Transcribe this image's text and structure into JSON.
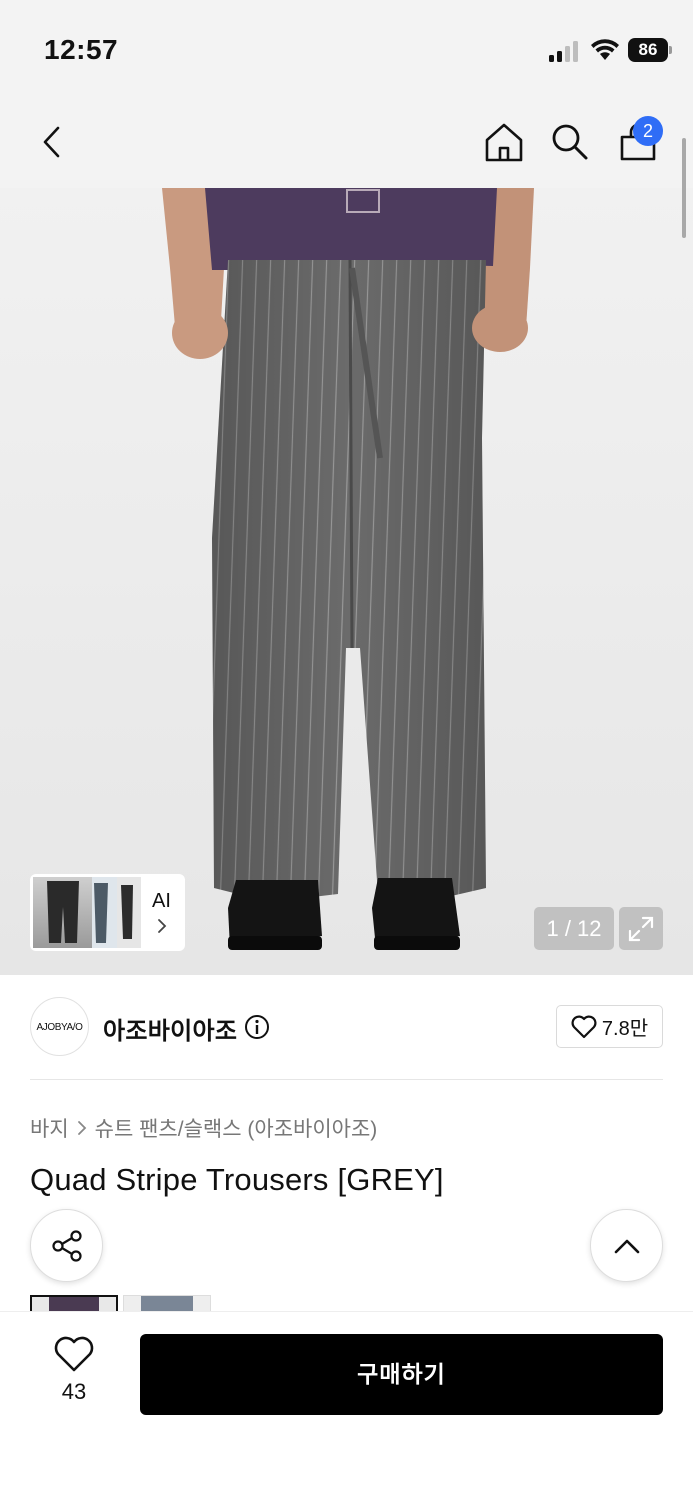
{
  "status_bar": {
    "time": "12:57",
    "battery": "86"
  },
  "nav": {
    "cart_count": "2"
  },
  "gallery": {
    "counter": "1 / 12",
    "ai_label": "AI"
  },
  "brand": {
    "logo_text": "AJOBYA/O",
    "name": "아조바이아조",
    "likes": "7.8만"
  },
  "breadcrumb": {
    "items": [
      "바지",
      "슈트 팬츠/슬랙스 (아조바이아조)"
    ]
  },
  "product": {
    "title": "Quad Stripe Trousers [GREY]"
  },
  "bottom": {
    "wish_count": "43",
    "buy_label": "구매하기"
  },
  "colors": {
    "accent": "#2f6df6",
    "buy_button": "#000000"
  },
  "icons": [
    "back-icon",
    "home-icon",
    "search-icon",
    "cart-icon",
    "expand-icon",
    "info-icon",
    "heart-icon",
    "share-icon",
    "chevron-up-icon",
    "chevron-right-icon"
  ]
}
